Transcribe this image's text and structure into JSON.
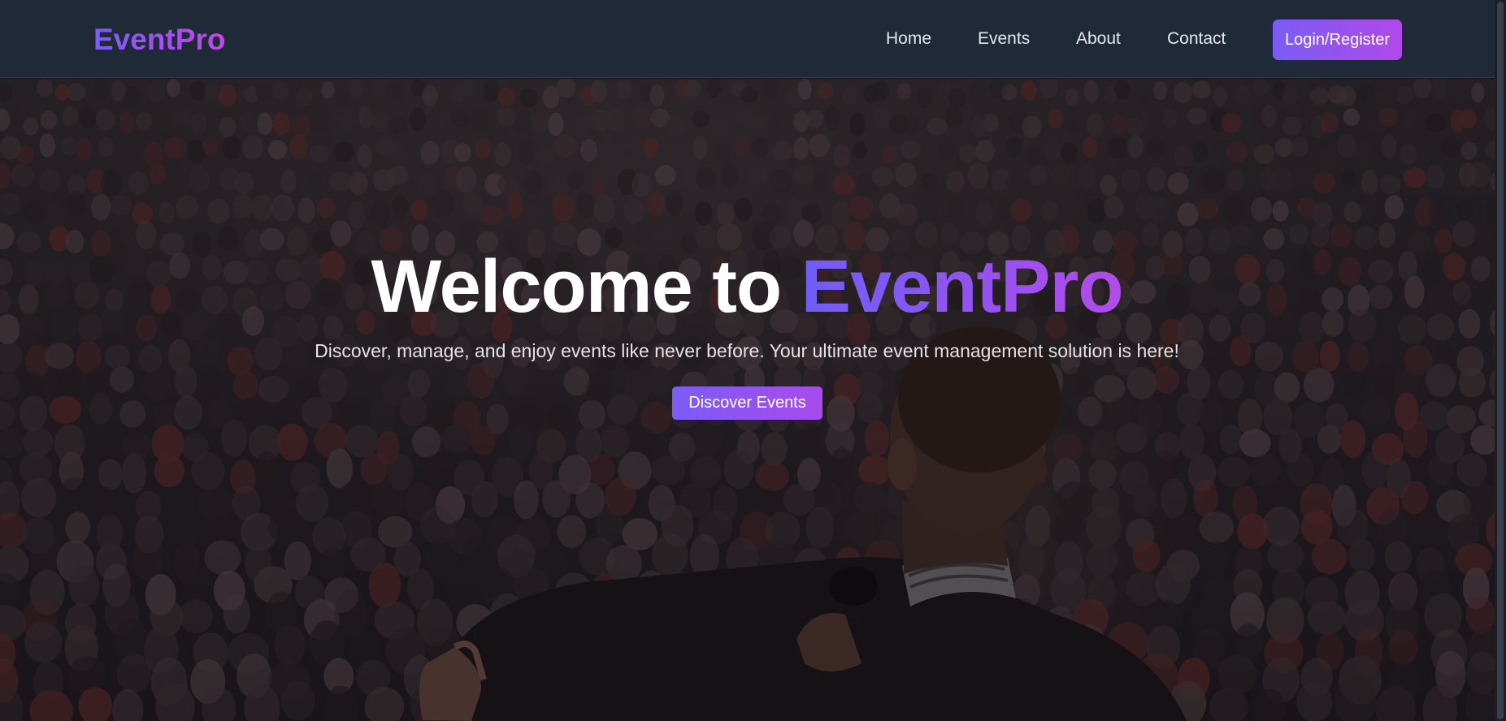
{
  "navbar": {
    "brand": "EventPro",
    "links": {
      "home": "Home",
      "events": "Events",
      "about": "About",
      "contact": "Contact"
    },
    "login_label": "Login/Register"
  },
  "hero": {
    "title_prefix": "Welcome to",
    "title_accent": "EventPro",
    "subtitle": "Discover, manage, and enjoy events like never before. Your ultimate event management solution is here!",
    "cta_label": "Discover Events",
    "background_image": "photo of a speaker holding a microphone addressing a large audience"
  },
  "colors": {
    "nav_bg": "#1f2937",
    "accent_start": "#7b5cf6",
    "accent_end": "#c347e6",
    "text_light": "#e5e7eb"
  }
}
